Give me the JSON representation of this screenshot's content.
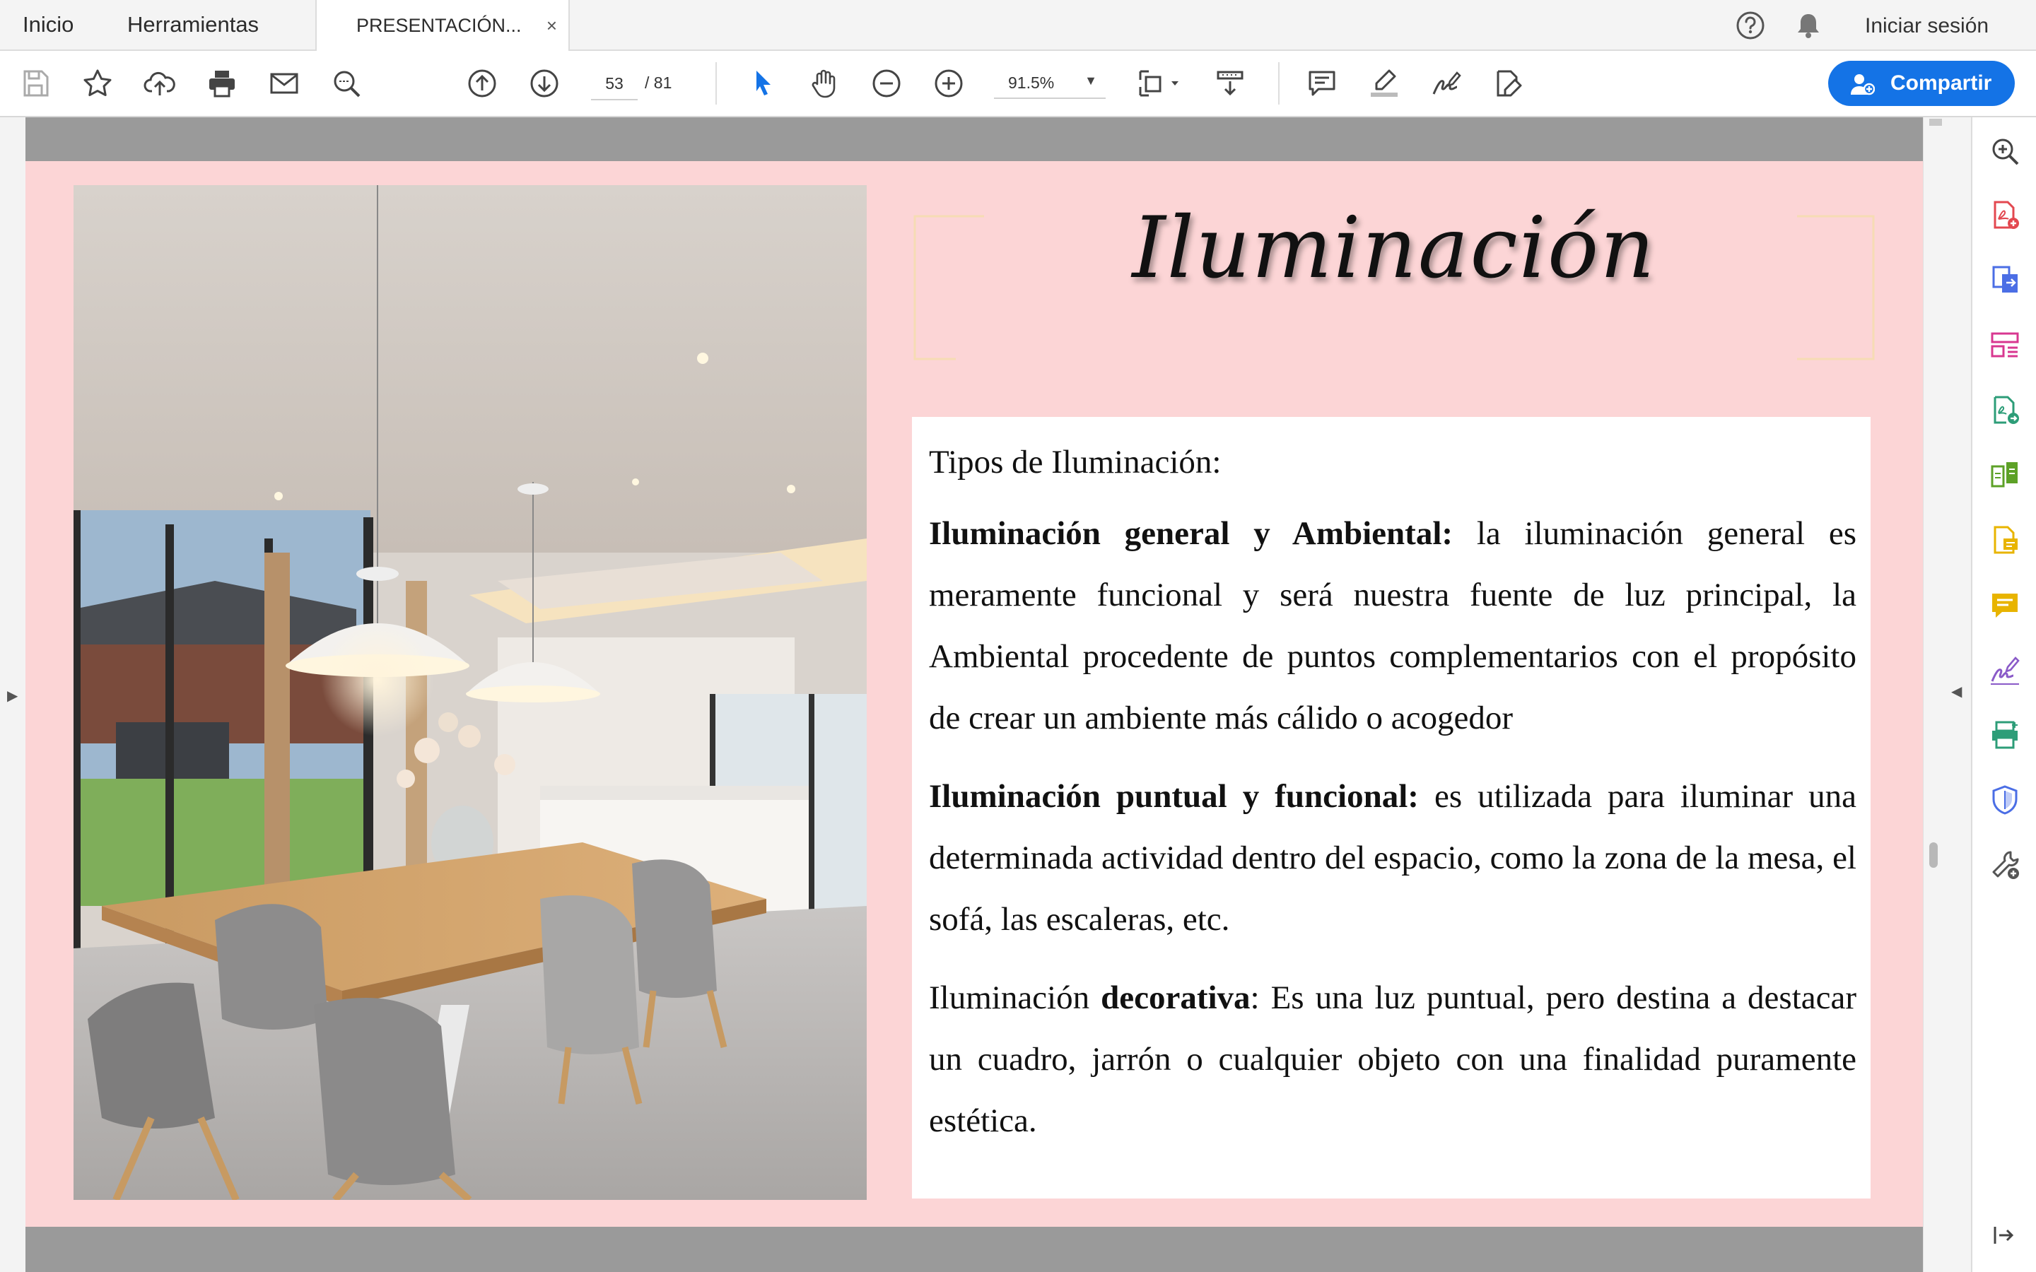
{
  "tabs": {
    "home": "Inicio",
    "tools": "Herramientas",
    "document": "PRESENTACIÓN...",
    "close": "×"
  },
  "header": {
    "sign_in": "Iniciar sesión",
    "icons": [
      "help-icon",
      "bell-icon"
    ]
  },
  "toolbar": {
    "icons": [
      "save-icon",
      "star-icon",
      "upload-cloud-icon",
      "print-icon",
      "email-icon",
      "search-icon",
      "page-up-icon",
      "page-down-icon",
      "select-arrow-icon",
      "hand-icon",
      "zoom-out-icon",
      "zoom-in-icon",
      "fit-page-icon",
      "scroll-mode-icon",
      "comment-icon",
      "highlight-icon",
      "sign-icon",
      "edit-icon"
    ],
    "current_page": "53",
    "total_pages": "/ 81",
    "zoom": "91.5%",
    "share_label": "Compartir"
  },
  "document": {
    "title": "Iluminación",
    "photo_description_icon": "dining-room-photo",
    "heading": "Tipos de Iluminación:",
    "paragraphs": {
      "general_bold": "Iluminación general y Ambiental:",
      "general_text": " la iluminación general es meramente funcional y será nuestra fuente de luz principal, la Ambiental procedente de puntos complementarios con el propósito de crear un ambiente más cálido o acogedor",
      "puntual_bold": "Iluminación puntual y funcional:",
      "puntual_text": " es utilizada para iluminar una determinada actividad dentro del espacio, como la zona de la mesa, el sofá, las escaleras, etc.",
      "decorativa_pre": "Iluminación ",
      "decorativa_bold": "decorativa",
      "decorativa_text": ": Es una luz puntual, pero destina a destacar un cuadro, jarrón  o cualquier objeto con una finalidad puramente estética."
    }
  },
  "right_panel": {
    "icons": [
      "search-zoom-icon",
      "create-pdf-icon",
      "export-pdf-icon",
      "organize-pages-icon",
      "send-file-icon",
      "compare-icon",
      "fill-sign-icon",
      "comment-tool-icon",
      "request-signature-icon",
      "scan-ocr-icon",
      "protect-icon",
      "more-tools-icon",
      "collapse-panel-icon"
    ],
    "colors": {
      "red": "#e34850",
      "blue": "#4b6ee5",
      "pink": "#d83790",
      "teal": "#2d9d78",
      "green": "#5da127",
      "yellow": "#e8b400",
      "purple": "#8a5ac8",
      "shield": "#4b6ee5",
      "gray": "#555555"
    }
  },
  "colors": {
    "page_background": "#fcd5d6",
    "share_button": "#1473e6",
    "select_arrow": "#1473e6"
  }
}
